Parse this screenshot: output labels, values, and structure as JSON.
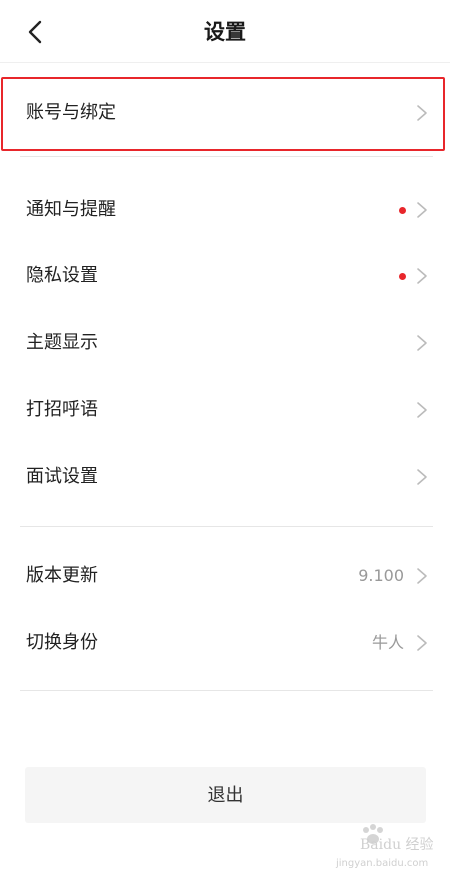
{
  "header": {
    "title": "设置",
    "back_icon": "chevron-left-icon"
  },
  "sections": [
    {
      "items": [
        {
          "label": "账号与绑定",
          "highlighted": true
        }
      ]
    },
    {
      "items": [
        {
          "label": "通知与提醒",
          "badge": true
        },
        {
          "label": "隐私设置",
          "badge": true
        },
        {
          "label": "主题显示"
        },
        {
          "label": "打招呼语"
        },
        {
          "label": "面试设置"
        }
      ]
    },
    {
      "items": [
        {
          "label": "版本更新",
          "value": "9.100"
        },
        {
          "label": "切换身份",
          "value": "牛人"
        }
      ]
    }
  ],
  "logout_label": "退出",
  "watermark": {
    "text": "Baidu 经验",
    "sub": "jingyan.baidu.com"
  },
  "colors": {
    "badge": "#e8262b",
    "highlight_border": "#e8262b",
    "chevron": "#bbbbbb"
  }
}
